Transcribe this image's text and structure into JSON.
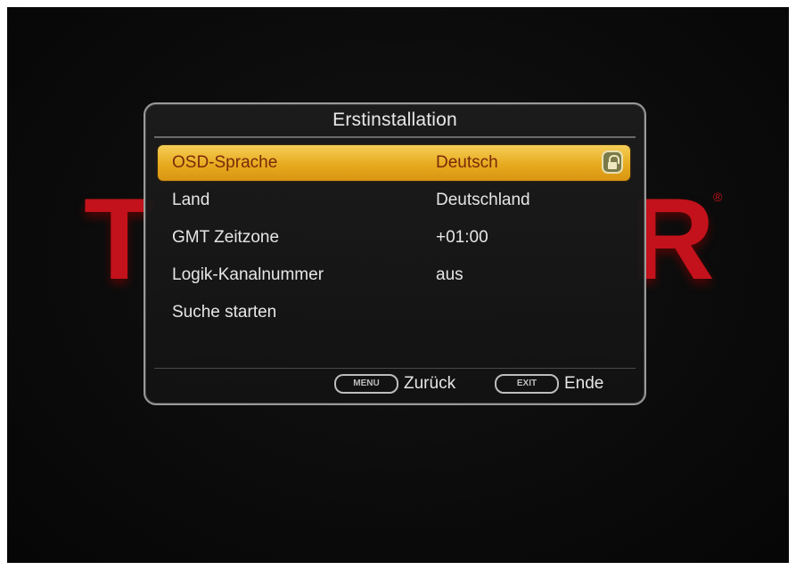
{
  "background": {
    "logo_left_letter": "T",
    "logo_right_letter": "R",
    "logo_registered": "®",
    "logo_color": "#c3121b"
  },
  "dialog": {
    "title": "Erstinstallation",
    "items": [
      {
        "label": "OSD-Sprache",
        "value": "Deutsch",
        "selected": true,
        "icon": "lock-icon"
      },
      {
        "label": "Land",
        "value": "Deutschland",
        "selected": false
      },
      {
        "label": "GMT Zeitzone",
        "value": "+01:00",
        "selected": false
      },
      {
        "label": "Logik-Kanalnummer",
        "value": "aus",
        "selected": false
      },
      {
        "label": "Suche starten",
        "value": "",
        "selected": false
      }
    ],
    "highlight_color": "#e7aa1e"
  },
  "footer": {
    "back_key": "MENU",
    "back_label": "Zurück",
    "exit_key": "EXIT",
    "exit_label": "Ende"
  }
}
